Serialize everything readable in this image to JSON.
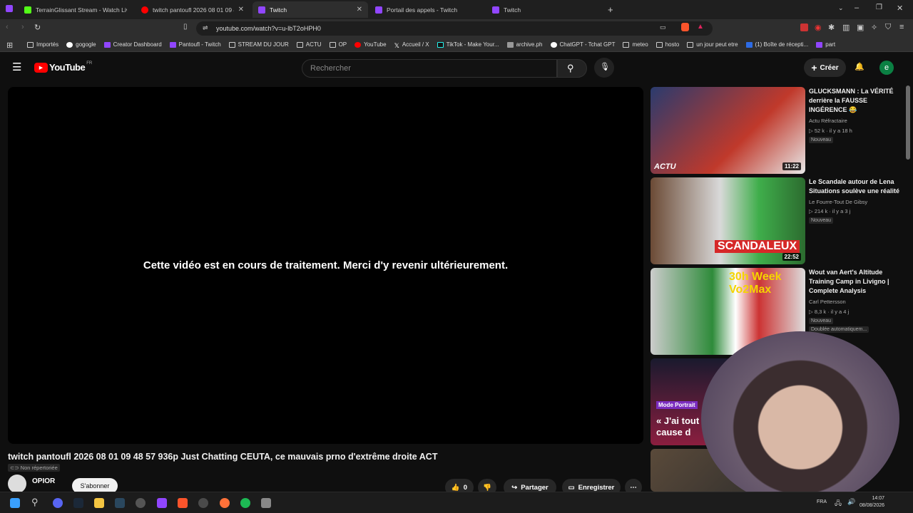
{
  "tabs": [
    {
      "label": "TerrainGlissant Stream - Watch Live o",
      "active": false
    },
    {
      "label": "twitch pantoufl 2026 08 01 09 48",
      "active": false
    },
    {
      "label": "Twitch",
      "active": true
    },
    {
      "label": "Portail des appels - Twitch",
      "active": false
    },
    {
      "label": "Twitch",
      "active": false
    }
  ],
  "address": {
    "url": "youtube.com/watch?v=u-lbT2oHPH0"
  },
  "bookmarks": [
    "Importés",
    "gogogle",
    "Creator Dashboard",
    "Pantoufl - Twitch",
    "STREAM DU JOUR",
    "ACTU",
    "OP",
    "YouTube",
    "Accueil / X",
    "TikTok - Make Your...",
    "archive.ph",
    "ChatGPT - Tchat GPT",
    "meteo",
    "hosto",
    "un jour peut etre",
    "(1) Boîte de récepti...",
    "part"
  ],
  "youtube": {
    "logo": "YouTube",
    "region": "FR",
    "search_placeholder": "Rechercher",
    "create_label": "Créer",
    "avatar_letter": "e"
  },
  "player": {
    "message": "Cette vidéo est en cours de traitement. Merci d'y revenir ultérieurement."
  },
  "video": {
    "title": "twitch pantoufl 2026 08 01 09 48 57 936p Just Chatting CEUTA, ce mauvais prno d'extrême droite ACT",
    "visibility": "Non répertoriée",
    "channel": "OPIOR",
    "subscribe_label": "S'abonner",
    "likes": "0",
    "share_label": "Partager",
    "save_label": "Enregistrer"
  },
  "recommendations": [
    {
      "title": "GLUCKSMANN : La VÉRITÉ derrière la FAUSSE INGÉRENCE 😂",
      "channel": "Actu Réfractaire",
      "meta": "52 k · il y a 18 h",
      "badge": "Nouveau",
      "duration": "11:22",
      "thumb_text": "ACTU"
    },
    {
      "title": "Le Scandale autour de Lena Situations soulève une réalité",
      "channel": "Le Fourre-Tout De Gibsy",
      "meta": "214 k · il y a 3 j",
      "badge": "Nouveau",
      "duration": "22:52",
      "thumb_text": "SCANDALEUX"
    },
    {
      "title": "Wout van Aert's Altitude Training Camp in Livigno | Complete Analysis",
      "channel": "Carl Pettersson",
      "meta": "8,3 k · il y a 4 j",
      "badge": "Nouveau",
      "extra": "Doublée automatiquem...",
      "thumb_text": "30h Week Vo2Max"
    },
    {
      "title": "",
      "thumb_tag": "Mode Portrait",
      "thumb_text": "« J'ai tout à cause d"
    }
  ],
  "taskbar": {
    "time": "14:07",
    "date": "08/08/2026",
    "lang": "FRA"
  },
  "colors": {
    "youtube_red": "#ff0000",
    "twitch_purple": "#9146ff"
  }
}
